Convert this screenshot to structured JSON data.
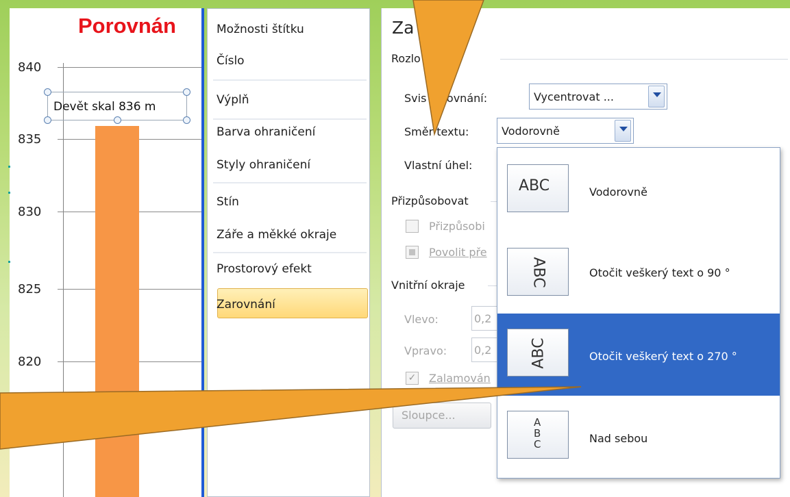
{
  "chart": {
    "title": "Porovnán",
    "y_ticks": [
      "840",
      "835",
      "830",
      "825",
      "820"
    ],
    "data_label": "Devět skal 836 m",
    "colors": {
      "bar": "#f79646",
      "title": "#e8141b"
    }
  },
  "chart_data": {
    "type": "bar",
    "title": "Porovnán",
    "categories": [
      "Devět skal"
    ],
    "values": [
      836
    ],
    "data_labels": [
      "Devět skal 836 m"
    ],
    "ylim": [
      815,
      842
    ],
    "ytick_labels": [
      "840",
      "835",
      "830",
      "825",
      "820"
    ],
    "grid": true
  },
  "categories": {
    "items": [
      {
        "label": "Možnosti štítku"
      },
      {
        "label": "Číslo"
      },
      {
        "label": "Výplň"
      },
      {
        "label": "Barva ohraničení"
      },
      {
        "label": "Styly ohraničení"
      },
      {
        "label": "Stín"
      },
      {
        "label": "Záře a měkké okraje"
      },
      {
        "label": "Prostorový efekt"
      },
      {
        "label": "Zarovnání"
      }
    ],
    "selected": "Zarovnání"
  },
  "pane": {
    "title": "Za   ání",
    "section_layout": "Rozlo     textu",
    "vertical_align_label": "Svis   zarovnání:",
    "vertical_align_value": "Vycentrovat ...",
    "text_direction_label": "Směr textu:",
    "text_direction_value": "Vodorovně",
    "custom_angle_label": "Vlastní úhel:",
    "section_autofit": "Přizpůsobovat",
    "autofit_option": "Přizpůsobi",
    "overflow_option": "Povolit pře",
    "section_margins": "Vnitřní okraje",
    "left_label": "Vlevo:",
    "left_value": "0,2",
    "right_label": "Vpravo:",
    "right_value": "0,2",
    "wrap_option": "Zalamován",
    "columns_button": "Sloupce..."
  },
  "dropdown": {
    "options": [
      {
        "label": "Vodorovně",
        "sample": "ABC",
        "orientation": "horizontal"
      },
      {
        "label": "Otočit veškerý text o 90 °",
        "sample": "ABC",
        "orientation": "rotate-90"
      },
      {
        "label": "Otočit veškerý text o 270 °",
        "sample": "ABC",
        "orientation": "rotate-270",
        "selected": true
      },
      {
        "label": "Nad sebou",
        "sample": "A B C",
        "orientation": "stacked"
      }
    ],
    "highlight_color": "#3169c6"
  },
  "callout_color": "#f0a12f"
}
